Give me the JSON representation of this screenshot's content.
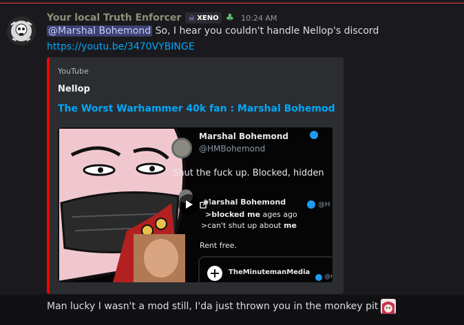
{
  "message": {
    "username": "Your local Truth Enforcer",
    "tag": "XENO",
    "badge_icon": "leaf-icon",
    "timestamp": "10:24 AM",
    "mention": "@Marshal Bohemond",
    "text": "So, I hear you couldn't handle Nellop's discord",
    "link": "https://youtu.be/3470VYBINGE"
  },
  "embed": {
    "provider": "YouTube",
    "author": "Nellop",
    "title": "The Worst Warhammer 40k fan : Marshal Bohemod",
    "accent": "#ff0000",
    "thumbnail": {
      "tweet_name": "Marshal Bohemond",
      "tweet_handle": "@HMBohemond",
      "tweet_text": "Shut the fuck up. Blocked, hidden",
      "reply_name": "Marshal Bohemond",
      "reply_handle": "@H",
      "reply_line1": ">blocked me",
      "reply_time": "ages ago",
      "reply_line2": ">can't shut up about",
      "reply_me": "me",
      "reply_line3": "Rent free.",
      "quote_name": "TheMinutemanMedia",
      "quote_handle": "@mi"
    }
  },
  "reply_message": {
    "text": "Man lucky I wasn't a mod still, I'da just thrown you in the monkey pit",
    "emoji": "anime-girl-emoji"
  },
  "colors": {
    "mention_bg": "#3c4270",
    "link": "#00a8fc",
    "divider": "#f23f43"
  }
}
